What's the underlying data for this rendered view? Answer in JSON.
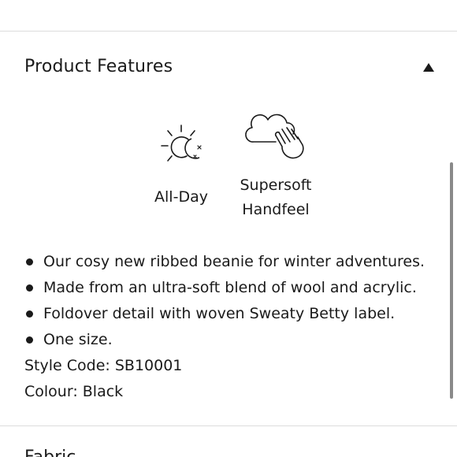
{
  "section": {
    "title": "Product Features",
    "toggle_icon": "triangle-up-icon",
    "expanded": true
  },
  "features": [
    {
      "icon": "sun-moon-icon",
      "label": "All-Day"
    },
    {
      "icon": "cloud-hand-icon",
      "label_line1": "Supersoft",
      "label_line2": "Handfeel"
    }
  ],
  "bullets": [
    "Our cosy new ribbed beanie for winter adventures.",
    "Made from an ultra-soft blend of wool and acrylic.",
    "Foldover detail with woven Sweaty Betty label.",
    "One size."
  ],
  "details": {
    "style_code": "Style Code: SB10001",
    "colour": "Colour: Black"
  },
  "next_section": {
    "title": "Fabric"
  },
  "colors": {
    "text": "#1a1a1a",
    "divider": "#dcdcdc",
    "scrollbar": "#8a8a8a"
  }
}
